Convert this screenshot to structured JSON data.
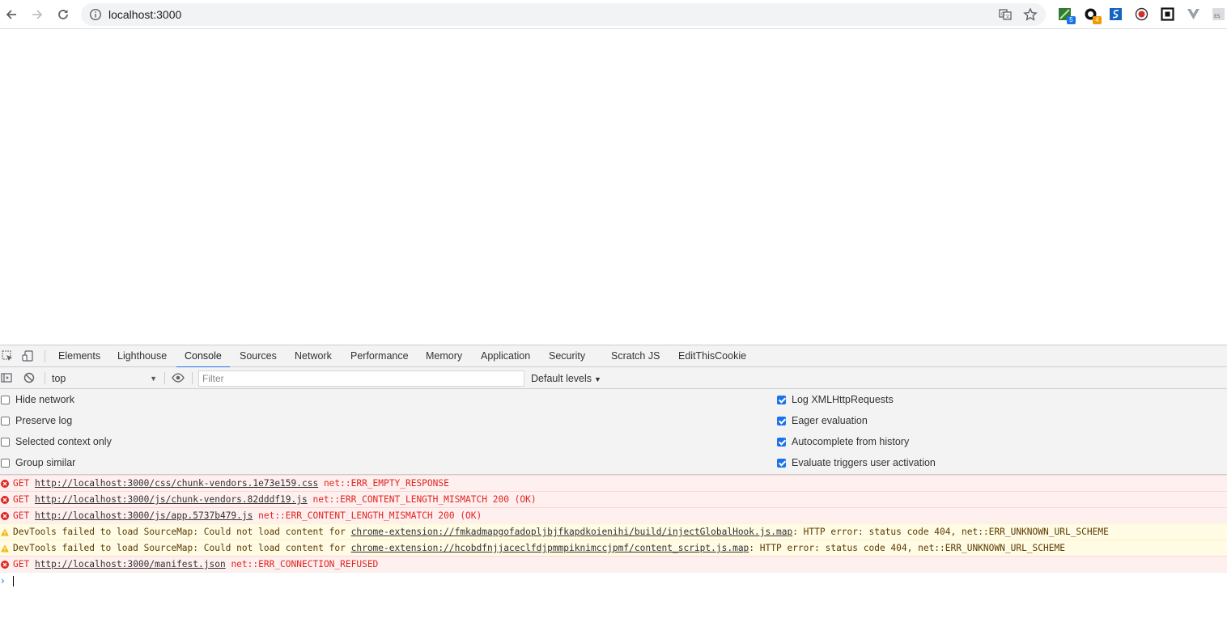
{
  "browser": {
    "url": "localhost:3000",
    "extensions": [
      {
        "icon": "green-book-extension-icon",
        "badge": "5",
        "badge_color": "#1a73e8"
      },
      {
        "icon": "octopus-extension-icon",
        "badge": "4",
        "badge_color": "#f29900"
      },
      {
        "icon": "s-extension-icon",
        "badge": null
      },
      {
        "icon": "red-circle-extension-icon",
        "badge": null
      },
      {
        "icon": "square-extension-icon",
        "badge": null
      },
      {
        "icon": "vue-extension-icon",
        "badge": null
      },
      {
        "icon": "es-extension-icon",
        "label": "ES"
      }
    ]
  },
  "devtools": {
    "tabs": [
      "Elements",
      "Lighthouse",
      "Console",
      "Sources",
      "Network",
      "Performance",
      "Memory",
      "Application",
      "Security",
      "Scratch JS",
      "EditThisCookie"
    ],
    "active_tab": "Console",
    "accent_color": "#1a73e8",
    "console": {
      "context": "top",
      "filter_placeholder": "Filter",
      "levels_label": "Default levels",
      "settings_left": [
        {
          "label": "Hide network",
          "checked": false
        },
        {
          "label": "Preserve log",
          "checked": false
        },
        {
          "label": "Selected context only",
          "checked": false
        },
        {
          "label": "Group similar",
          "checked": false
        }
      ],
      "settings_right": [
        {
          "label": "Log XMLHttpRequests",
          "checked": true
        },
        {
          "label": "Eager evaluation",
          "checked": true
        },
        {
          "label": "Autocomplete from history",
          "checked": true
        },
        {
          "label": "Evaluate triggers user activation",
          "checked": true
        }
      ],
      "messages": [
        {
          "level": "error",
          "prefix": "GET ",
          "link": "http://localhost:3000/css/chunk-vendors.1e73e159.css",
          "suffix": " net::ERR_EMPTY_RESPONSE"
        },
        {
          "level": "error",
          "prefix": "GET ",
          "link": "http://localhost:3000/js/chunk-vendors.82dddf19.js",
          "suffix": " net::ERR_CONTENT_LENGTH_MISMATCH 200 (OK)"
        },
        {
          "level": "error",
          "prefix": "GET ",
          "link": "http://localhost:3000/js/app.5737b479.js",
          "suffix": " net::ERR_CONTENT_LENGTH_MISMATCH 200 (OK)"
        },
        {
          "level": "warning",
          "prefix": "DevTools failed to load SourceMap: Could not load content for ",
          "link": "chrome-extension://fmkadmapgofadopljbjfkapdkoienihi/build/injectGlobalHook.js.map",
          "suffix": ": HTTP error: status code 404, net::ERR_UNKNOWN_URL_SCHEME"
        },
        {
          "level": "warning",
          "prefix": "DevTools failed to load SourceMap: Could not load content for ",
          "link": "chrome-extension://hcobdfnjjaceclfdjpmmpiknimccjpmf/content_script.js.map",
          "suffix": ": HTTP error: status code 404, net::ERR_UNKNOWN_URL_SCHEME"
        },
        {
          "level": "error",
          "prefix": "GET ",
          "link": "http://localhost:3000/manifest.json",
          "suffix": " net::ERR_CONNECTION_REFUSED"
        }
      ],
      "error_color": "#e0251f",
      "warning_bg": "#fffbe5",
      "error_bg": "#fff0f0"
    }
  }
}
